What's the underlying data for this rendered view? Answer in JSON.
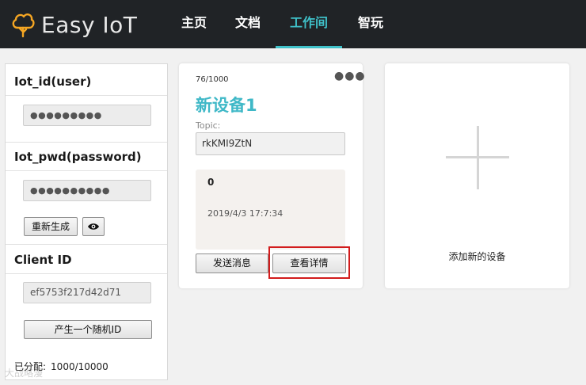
{
  "brand": {
    "name": "Easy IoT",
    "logo_icon": "cloud-tree-icon",
    "accent": "#f5a623"
  },
  "nav": {
    "items": [
      {
        "label": "主页",
        "active": false
      },
      {
        "label": "文档",
        "active": false
      },
      {
        "label": "工作间",
        "active": true
      },
      {
        "label": "智玩",
        "active": false
      }
    ],
    "active_color": "#3fc1c9"
  },
  "sidebar": {
    "iot_id_label": "Iot_id(user)",
    "iot_id_value": "●●●●●●●●●",
    "iot_pwd_label": "Iot_pwd(password)",
    "iot_pwd_value": "●●●●●●●●●●",
    "regenerate_label": "重新生成",
    "toggle_icon": "eye-icon",
    "client_id_label": "Client ID",
    "client_id_value": "ef5753f217d42d71",
    "random_id_label": "产生一个随机ID",
    "assigned_label": "已分配:",
    "assigned_value": "1000/10000"
  },
  "device": {
    "count": "76/1000",
    "more_icon": "more-dots-icon",
    "name": "新设备1",
    "topic_label": "Topic:",
    "topic_value": "rkKMI9ZtN",
    "last_message_value": "0",
    "last_message_time": "2019/4/3 17:7:34",
    "send_button": "发送消息",
    "detail_button": "查看详情"
  },
  "add_device": {
    "label": "添加新的设备",
    "icon": "plus-icon"
  },
  "watermark": "大战略漫"
}
